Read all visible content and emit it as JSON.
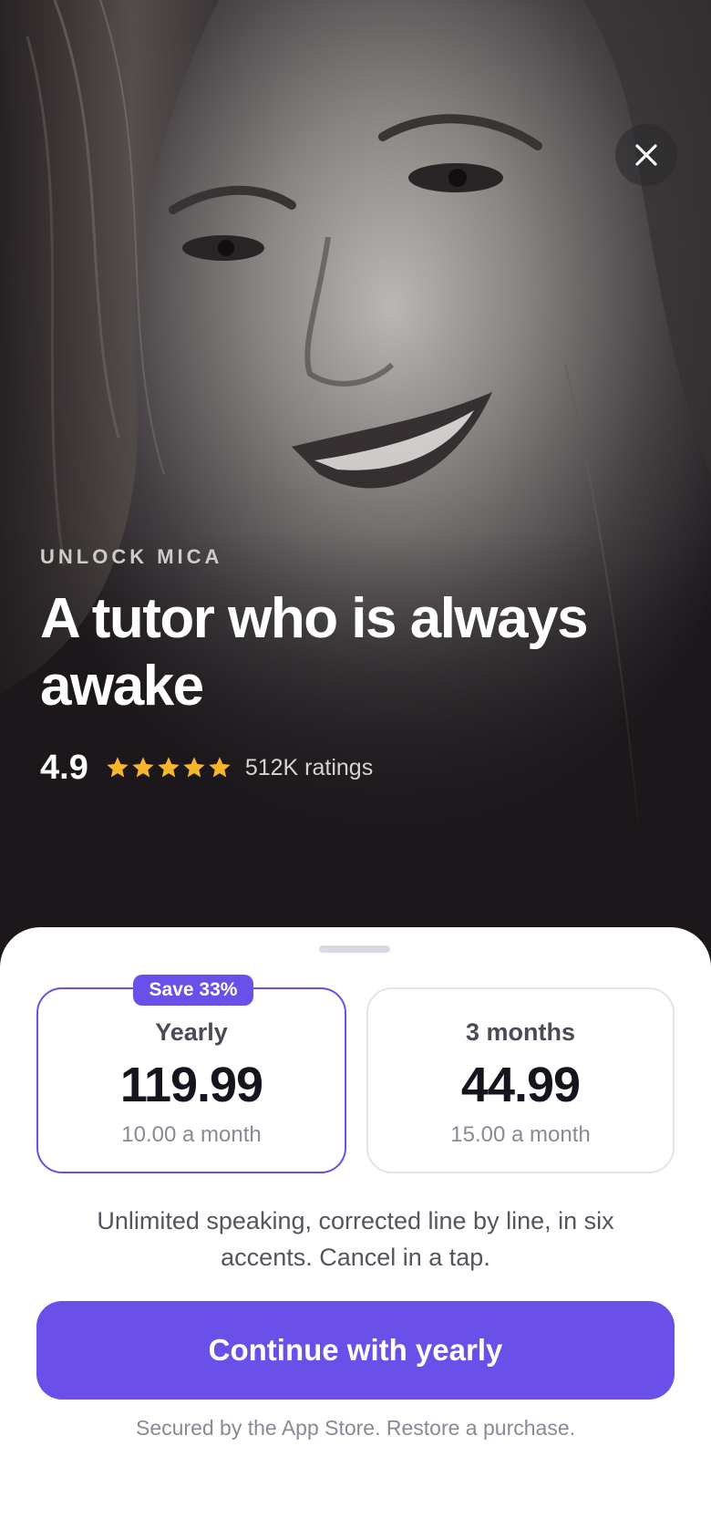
{
  "hero": {
    "eyebrow": "UNLOCK MICA",
    "headline": "A tutor who is always awake",
    "rating_score": "4.9",
    "stars": 5,
    "rating_count": "512K ratings",
    "star_color": "#F5B62B",
    "photo": "woman-portrait-black-and-white"
  },
  "close_icon": "close-icon",
  "plans": {
    "yearly": {
      "badge": "Save 33%",
      "name": "Yearly",
      "price": "119.99",
      "per_month": "10.00 a month",
      "selected": true
    },
    "quarter": {
      "name": "3 months",
      "price": "44.99",
      "per_month": "15.00 a month",
      "selected": false
    }
  },
  "description": "Unlimited speaking, corrected line by line, in six accents. Cancel in a tap.",
  "cta_label": "Continue with yearly",
  "footer_text": "Secured by the App Store. Restore a purchase.",
  "colors": {
    "accent": "#6A4FE8",
    "hero_bg": "#1B171B"
  }
}
